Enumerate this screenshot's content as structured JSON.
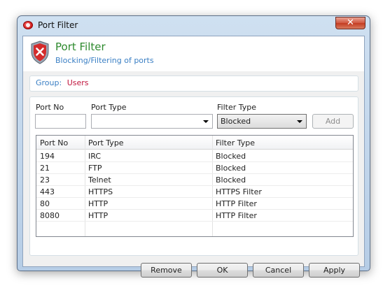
{
  "window": {
    "title": "Port Filter",
    "close_glyph": "✕"
  },
  "header": {
    "title": "Port Filter",
    "subtitle": "Blocking/Filtering of ports"
  },
  "group": {
    "label": "Group:",
    "value": "Users"
  },
  "form": {
    "port_no_label": "Port No",
    "port_no_value": "",
    "port_type_label": "Port Type",
    "port_type_value": "",
    "filter_type_label": "Filter Type",
    "filter_type_value": "Blocked",
    "add_label": "Add"
  },
  "table": {
    "columns": [
      "Port No",
      "Port Type",
      "Filter Type"
    ],
    "rows": [
      [
        "194",
        "IRC",
        "Blocked"
      ],
      [
        "21",
        "FTP",
        "Blocked"
      ],
      [
        "23",
        "Telnet",
        "Blocked"
      ],
      [
        "443",
        "HTTPS",
        "HTTPS Filter"
      ],
      [
        "80",
        "HTTP",
        "HTTP Filter"
      ],
      [
        "8080",
        "HTTP",
        "HTTP Filter"
      ]
    ]
  },
  "buttons": {
    "remove": "Remove",
    "ok": "OK",
    "cancel": "Cancel",
    "apply": "Apply"
  },
  "colors": {
    "title_green": "#2d8a2d",
    "subtitle_blue": "#3a7fc4",
    "group_red": "#c0143c"
  }
}
